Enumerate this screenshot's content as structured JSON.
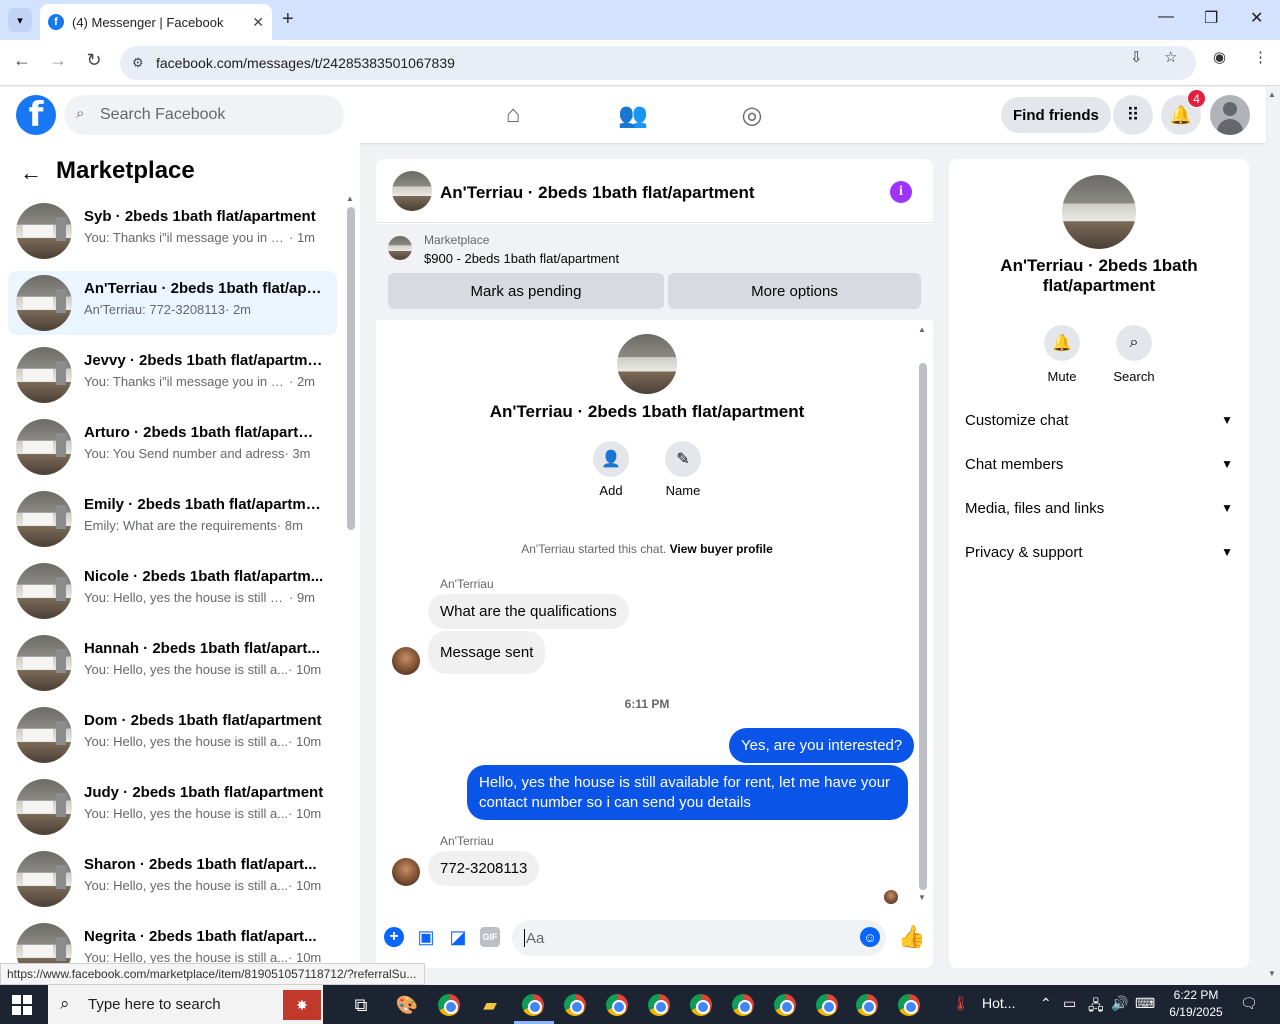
{
  "browser": {
    "tab_title": "(4) Messenger | Facebook",
    "url": "facebook.com/messages/t/24285383501067839",
    "status_url": "https://www.facebook.com/marketplace/item/819051057118712/?referralSu..."
  },
  "fb": {
    "logo": "f",
    "search_placeholder": "Search Facebook",
    "find_friends": "Find friends",
    "notification_count": "4",
    "brand_color": "#1877f2"
  },
  "sidebar": {
    "title": "Marketplace",
    "conversations": [
      {
        "name": "Syb · 2beds 1bath flat/apartment",
        "preview": "You: Thanks i\"il message you in a ...",
        "time": "· 1m"
      },
      {
        "name": "An'Terriau · 2beds 1bath flat/apa...",
        "preview": "An'Terriau: 772-3208113",
        "time": "· 2m"
      },
      {
        "name": "Jevvy · 2beds 1bath flat/apartme...",
        "preview": "You: Thanks i\"il message you in a ...",
        "time": "· 2m"
      },
      {
        "name": "Arturo · 2beds 1bath flat/apartm...",
        "preview": "You: You Send number and adress",
        "time": "· 3m"
      },
      {
        "name": "Emily · 2beds 1bath flat/apartme...",
        "preview": "Emily: What are the requirements",
        "time": "· 8m"
      },
      {
        "name": "Nicole · 2beds 1bath flat/apartm...",
        "preview": "You: Hello, yes the house is still av...",
        "time": "· 9m"
      },
      {
        "name": "Hannah · 2beds 1bath flat/apart...",
        "preview": "You: Hello, yes the house is still a...",
        "time": "· 10m"
      },
      {
        "name": "Dom · 2beds 1bath flat/apartment",
        "preview": "You: Hello, yes the house is still a...",
        "time": "· 10m"
      },
      {
        "name": "Judy · 2beds 1bath flat/apartment",
        "preview": "You: Hello, yes the house is still a...",
        "time": "· 10m"
      },
      {
        "name": "Sharon · 2beds 1bath flat/apart...",
        "preview": "You: Hello, yes the house is still a...",
        "time": "· 10m"
      },
      {
        "name": "Negrita · 2beds 1bath flat/apart...",
        "preview": "You: Hello, yes the house is still a...",
        "time": "· 10m"
      }
    ]
  },
  "chat": {
    "title": "An'Terriau · 2beds 1bath flat/apartment",
    "marketplace_label": "Marketplace",
    "listing": "$900 - 2beds 1bath flat/apartment",
    "mark_pending": "Mark as pending",
    "more_options": "More options",
    "center_name": "An'Terriau · 2beds 1bath flat/apartment",
    "add_label": "Add",
    "name_label": "Name",
    "started_text": "An'Terriau started this chat.",
    "view_buyer": "View buyer profile",
    "sender1": "An'Terriau",
    "msg1": "What are the qualifications",
    "msg2": "Message sent",
    "timestamp": "6:11 PM",
    "msg3": "Yes, are you interested?",
    "msg4": "Hello, yes the house is still available for rent, let me have your contact number so i can send you details",
    "sender2": "An'Terriau",
    "msg5": "772-3208113",
    "input_placeholder": "Aa",
    "gif_label": "GIF"
  },
  "info_panel": {
    "name": "An'Terriau · 2beds 1bath flat/apartment",
    "mute": "Mute",
    "search": "Search",
    "sections": [
      "Customize chat",
      "Chat members",
      "Media, files and links",
      "Privacy & support"
    ]
  },
  "taskbar": {
    "search_placeholder": "Type here to search",
    "weather": "Hot...",
    "time": "6:22 PM",
    "date": "6/19/2025"
  }
}
